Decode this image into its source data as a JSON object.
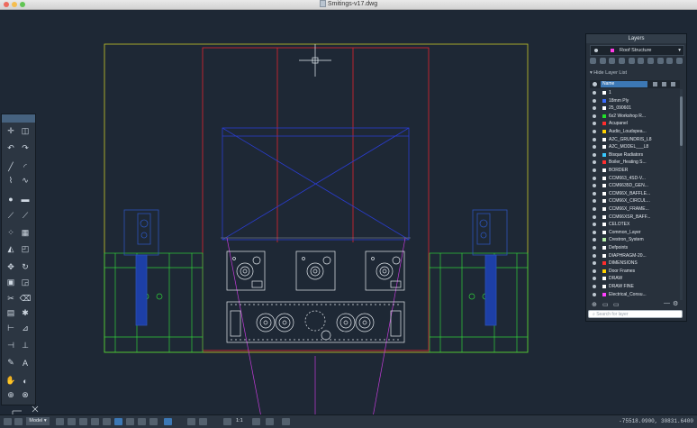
{
  "window": {
    "title": "Smitings-v17.dwg"
  },
  "layers_panel": {
    "title": "Layers",
    "current_layer": "Roof Structure",
    "hide_list_label": "Hide Layer List",
    "name_column": "Name",
    "rows": [
      {
        "name": "1",
        "color": "#ffffff"
      },
      {
        "name": "18mm Ply",
        "color": "#3b6cff"
      },
      {
        "name": "25_090601",
        "color": "#ffffff"
      },
      {
        "name": "6x2 Workshop R...",
        "color": "#22e22a"
      },
      {
        "name": "Acupanel",
        "color": "#ff2d2d"
      },
      {
        "name": "Audio_Loudspea...",
        "color": "#ffd000"
      },
      {
        "name": "A2C_GRUNDRIS_L8",
        "color": "#ffffff"
      },
      {
        "name": "A2C_MODEL___L8",
        "color": "#ffffff"
      },
      {
        "name": "Bisque Radiators",
        "color": "#37c9ff"
      },
      {
        "name": "Boiler_Heating S...",
        "color": "#ff3030"
      },
      {
        "name": "BORDER",
        "color": "#ffffff"
      },
      {
        "name": "CCM663_4SD-V...",
        "color": "#ffffff"
      },
      {
        "name": "CCM6635D_GEN...",
        "color": "#ffffff"
      },
      {
        "name": "CCM66X_BAFFLE...",
        "color": "#ffffff"
      },
      {
        "name": "CCM66X_CIRCUL...",
        "color": "#ffffff"
      },
      {
        "name": "CCM66X_FRAME...",
        "color": "#ffffff"
      },
      {
        "name": "CCM66XSR_BAFF...",
        "color": "#ffffff"
      },
      {
        "name": "CELOTEX",
        "color": "#ffffff"
      },
      {
        "name": "Common_Layer",
        "color": "#ffffff"
      },
      {
        "name": "Crestron_System",
        "color": "#b8f0a8"
      },
      {
        "name": "Defpoints",
        "color": "#ffffff"
      },
      {
        "name": "DIAPHRAGM-20...",
        "color": "#ffffff"
      },
      {
        "name": "DIMENSIONS",
        "color": "#ff2d2d"
      },
      {
        "name": "Door Frames",
        "color": "#ffd000"
      },
      {
        "name": "DRAW",
        "color": "#ffffff"
      },
      {
        "name": "DRAW FINE",
        "color": "#ffffff"
      },
      {
        "name": "Electrical_Consu...",
        "color": "#ff40ff"
      }
    ],
    "search_placeholder": "Search for layer"
  },
  "status_bar": {
    "model_tab": "Model",
    "scale": "1:1",
    "coordinates": "-75518.0900, 30831.6400"
  }
}
